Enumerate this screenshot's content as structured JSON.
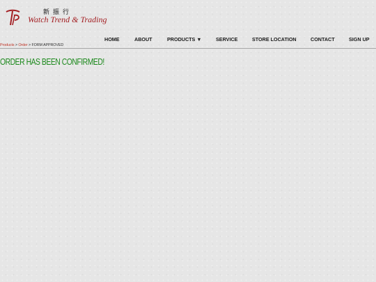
{
  "brand": {
    "name_cn": "新振行",
    "name_en": "Watch Trend & Trading",
    "accent_color": "#a31e22",
    "logo_icon": "tp-monogram-icon"
  },
  "nav": {
    "items": [
      {
        "label": "HOME"
      },
      {
        "label": "ABOUT"
      },
      {
        "label": "PRODUCTS ▼"
      },
      {
        "label": "SERVICE"
      },
      {
        "label": "STORE LOCATION"
      },
      {
        "label": "CONTACT"
      },
      {
        "label": "SIGN UP"
      }
    ]
  },
  "breadcrumb": {
    "link1": "Products",
    "sep1": " > ",
    "link2": "Order",
    "sep2": " > ",
    "current": "FORM APPROVED"
  },
  "main": {
    "headline": "ORDER HAS BEEN CONFIRMED!",
    "headline_color": "#1e8a1e"
  }
}
